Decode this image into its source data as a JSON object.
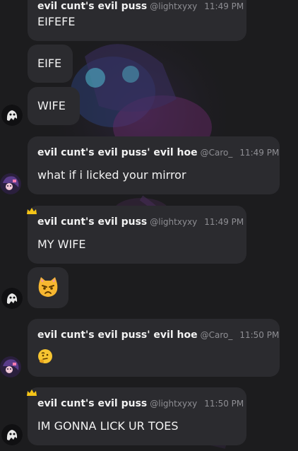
{
  "chat": {
    "messages": [
      {
        "name": "evil cunt's evil puss",
        "handle": "@lightxyxy",
        "time": "11:49 PM",
        "text": "EIFEFE"
      },
      {
        "text": "EIFE"
      },
      {
        "text": "WIFE"
      },
      {
        "name": "evil cunt's evil puss' evil hoe",
        "handle": "@Caro_",
        "time": "11:49 PM",
        "text": "what if i licked your mirror"
      },
      {
        "name": "evil cunt's evil puss",
        "handle": "@lightxyxy",
        "time": "11:49 PM",
        "text": "MY WIFE"
      },
      {
        "emoji": "pouting-cat-emoji"
      },
      {
        "name": "evil cunt's evil puss' evil hoe",
        "handle": "@Caro_",
        "time": "11:50 PM",
        "emoji": "thinking-face-emoji"
      },
      {
        "name": "evil cunt's evil puss",
        "handle": "@lightxyxy",
        "time": "11:50 PM",
        "text": "IM GONNA LICK UR TOES"
      }
    ]
  },
  "colors": {
    "background": "#1c1c1e",
    "bubble": "#2b2b2f",
    "meta_text": "#8e8e93",
    "crown": "#f5c518"
  }
}
